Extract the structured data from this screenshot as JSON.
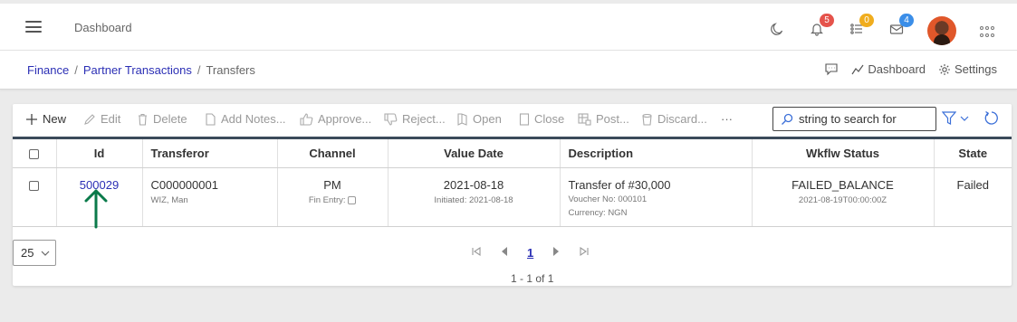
{
  "topbar": {
    "title": "Dashboard",
    "notifications": {
      "bell_count": "5",
      "tasks_count": "0",
      "mail_count": "4"
    },
    "colors": {
      "bell_badge": "#e5534b",
      "tasks_badge": "#f0ad1e",
      "mail_badge": "#3b8ee8"
    }
  },
  "breadcrumb": {
    "items": [
      "Finance",
      "Partner Transactions"
    ],
    "current": "Transfers"
  },
  "header_actions": {
    "dashboard": "Dashboard",
    "settings": "Settings"
  },
  "toolbar": {
    "new": "New",
    "edit": "Edit",
    "delete": "Delete",
    "add_notes": "Add Notes...",
    "approve": "Approve...",
    "reject": "Reject...",
    "open": "Open",
    "close": "Close",
    "post": "Post...",
    "discard": "Discard...",
    "more": "···",
    "search_value": "string to search for"
  },
  "table": {
    "columns": [
      "Id",
      "Transferor",
      "Channel",
      "Value Date",
      "Description",
      "Wkflw Status",
      "State"
    ],
    "rows": [
      {
        "id": "500029",
        "transferor": "C000000001",
        "transferor_sub": "WIZ, Man",
        "channel": "PM",
        "channel_sub": "Fin Entry:",
        "value_date": "2021-08-18",
        "value_date_sub": "Initiated: 2021-08-18",
        "description": "Transfer of #30,000",
        "description_sub1": "Voucher No: 000101",
        "description_sub2": "Currency: NGN",
        "wkflw_status": "FAILED_BALANCE",
        "wkflw_status_sub": "2021-08-19T00:00:00Z",
        "state": "Failed"
      }
    ]
  },
  "pager": {
    "page_size": "25",
    "current_page": "1",
    "info": "1 - 1 of 1"
  },
  "colors": {
    "accent": "#2b2fb5",
    "annotation": "#0a7a4a",
    "header_rule": "#3b4a5a"
  }
}
